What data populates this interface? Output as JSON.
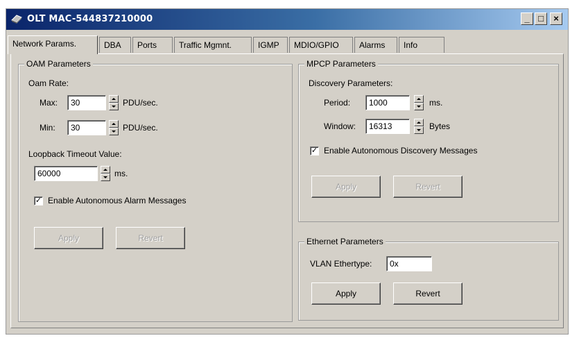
{
  "window": {
    "title": "OLT MAC-544837210000",
    "minimize_glyph": "_",
    "maximize_glyph": "□",
    "close_glyph": "×",
    "icon": "network-device-icon"
  },
  "tabs": [
    {
      "label": "Network Params.",
      "active": true
    },
    {
      "label": "DBA",
      "active": false
    },
    {
      "label": "Ports",
      "active": false
    },
    {
      "label": "Traffic Mgmnt.",
      "active": false
    },
    {
      "label": "IGMP",
      "active": false
    },
    {
      "label": "MDIO/GPIO",
      "active": false
    },
    {
      "label": "Alarms",
      "active": false
    },
    {
      "label": "Info",
      "active": false
    }
  ],
  "oam": {
    "legend": "OAM Parameters",
    "rate_label": "Oam Rate:",
    "max_label": "Max:",
    "max_value": "30",
    "min_label": "Min:",
    "min_value": "30",
    "unit_pdu": "PDU/sec.",
    "loopback_label": "Loopback Timeout Value:",
    "loopback_value": "60000",
    "unit_ms": "ms.",
    "alarm_checkbox_label": "Enable Autonomous Alarm Messages",
    "alarm_checked": true,
    "check_glyph": "✓",
    "apply_label": "Apply",
    "revert_label": "Revert"
  },
  "mpcp": {
    "legend": "MPCP Parameters",
    "discovery_label": "Discovery Parameters:",
    "period_label": "Period:",
    "period_value": "1000",
    "unit_ms": "ms.",
    "window_label": "Window:",
    "window_value": "16313",
    "unit_bytes": "Bytes",
    "discovery_checkbox_label": "Enable Autonomous Discovery Messages",
    "discovery_checked": true,
    "apply_label": "Apply",
    "revert_label": "Revert"
  },
  "ethernet": {
    "legend": "Ethernet Parameters",
    "vlan_label": "VLAN Ethertype:",
    "vlan_value": "0x",
    "apply_label": "Apply",
    "revert_label": "Revert"
  },
  "colors": {
    "titlebar_start": "#0a246a",
    "titlebar_end": "#a6caf0",
    "face": "#d4d0c8"
  }
}
